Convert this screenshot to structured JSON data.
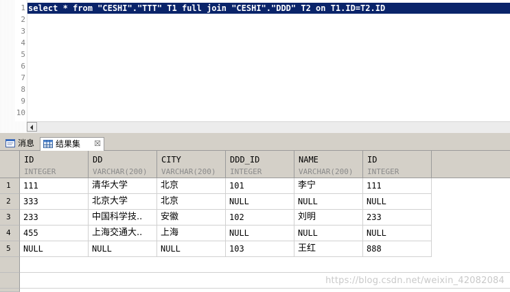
{
  "editor": {
    "line_numbers": [
      "1",
      "2",
      "3",
      "4",
      "5",
      "6",
      "7",
      "8",
      "9",
      "10"
    ],
    "sql": "select * from \"CESHI\".\"TTT\" T1 full join \"CESHI\".\"DDD\" T2 on T1.ID=T2.ID"
  },
  "tabs": {
    "messages_label": "消息",
    "results_label": "结果集",
    "close_glyph": "☒",
    "messages_icon": "message-list-icon",
    "results_icon": "table-grid-icon"
  },
  "grid": {
    "columns": [
      {
        "name": "ID",
        "type": "INTEGER"
      },
      {
        "name": "DD",
        "type": "VARCHAR(200)"
      },
      {
        "name": "CITY",
        "type": "VARCHAR(200)"
      },
      {
        "name": "DDD_ID",
        "type": "INTEGER"
      },
      {
        "name": "NAME",
        "type": "VARCHAR(200)"
      },
      {
        "name": "ID",
        "type": "INTEGER"
      }
    ],
    "rows": [
      {
        "num": "1",
        "cells": [
          "111",
          "清华大学",
          "北京",
          "101",
          "李宁",
          "111"
        ]
      },
      {
        "num": "2",
        "cells": [
          "333",
          "北京大学",
          "北京",
          "NULL",
          "NULL",
          "NULL"
        ]
      },
      {
        "num": "3",
        "cells": [
          "233",
          "中国科学技..",
          "安徽",
          "102",
          "刘明",
          "233"
        ]
      },
      {
        "num": "4",
        "cells": [
          "455",
          "上海交通大..",
          "上海",
          "NULL",
          "NULL",
          "NULL"
        ]
      },
      {
        "num": "5",
        "cells": [
          "NULL",
          "NULL",
          "NULL",
          "103",
          "王红",
          "888"
        ]
      }
    ]
  },
  "watermark": "https://blog.csdn.net/weixin_42082084",
  "colors": {
    "selection": "#0a246a",
    "panel": "#d4d0c8"
  }
}
